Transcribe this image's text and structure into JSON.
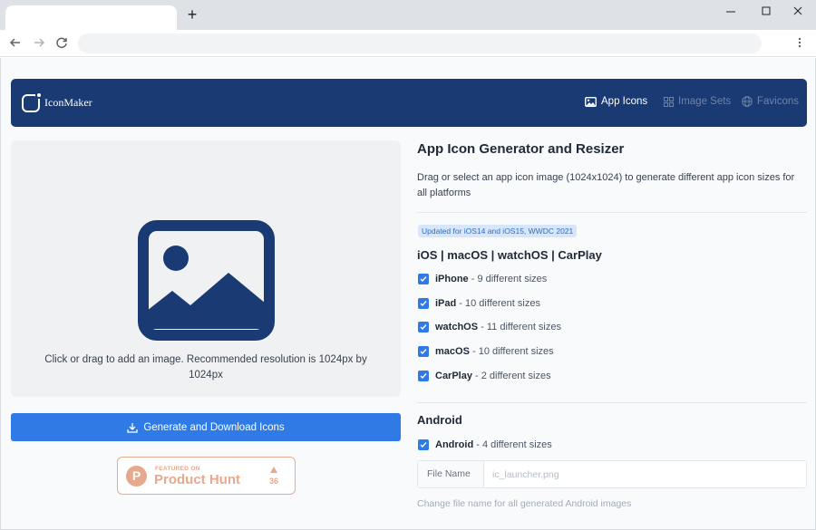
{
  "app": {
    "brand": "IconMaker",
    "nav": [
      {
        "label": "App Icons",
        "icon": "image-icon",
        "active": true
      },
      {
        "label": "Image Sets",
        "icon": "grid-icon",
        "active": false
      },
      {
        "label": "Favicons",
        "icon": "globe-icon",
        "active": false
      }
    ]
  },
  "dropzone": {
    "text": "Click or drag to add an image. Recommended resolution is 1024px by 1024px"
  },
  "generate_button": {
    "label": "Generate and Download Icons",
    "icon": "download-icon"
  },
  "product_hunt": {
    "featured": "FEATURED ON",
    "name": "Product Hunt",
    "votes": "36"
  },
  "main": {
    "title": "App Icon Generator and Resizer",
    "description": "Drag or select an app icon image (1024x1024) to generate different app icon sizes for all platforms",
    "badge": "Updated for iOS14 and iOS15, WWDC 2021",
    "apple": {
      "heading": "iOS | macOS | watchOS | CarPlay",
      "options": [
        {
          "name": "iPhone",
          "detail": " - 9 different sizes",
          "checked": true
        },
        {
          "name": "iPad",
          "detail": " - 10 different sizes",
          "checked": true
        },
        {
          "name": "watchOS",
          "detail": " - 11 different sizes",
          "checked": true
        },
        {
          "name": "macOS",
          "detail": " - 10 different sizes",
          "checked": true
        },
        {
          "name": "CarPlay",
          "detail": " - 2 different sizes",
          "checked": true
        }
      ]
    },
    "android": {
      "heading": "Android",
      "option": {
        "name": "Android",
        "detail": " - 4 different sizes",
        "checked": true
      },
      "file_name_label": "File Name",
      "file_name_placeholder": "ic_launcher.png",
      "help": "Change file name for all generated Android images"
    }
  },
  "colors": {
    "navy": "#1a3a73",
    "accent": "#2f7ae5",
    "product_hunt": "#e7a98d"
  }
}
